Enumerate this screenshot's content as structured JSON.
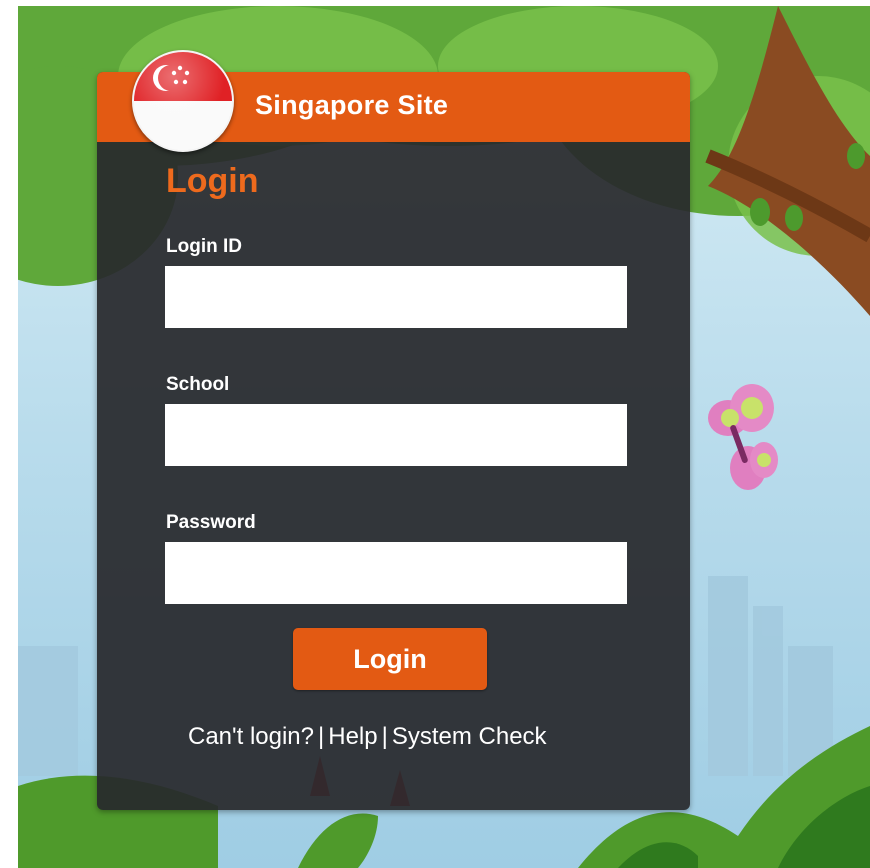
{
  "header": {
    "site_title": "Singapore Site"
  },
  "flag": {
    "icon": "singapore-flag-icon",
    "red": "#e02125",
    "white": "#fafafa"
  },
  "form": {
    "heading": "Login",
    "login_id": {
      "label": "Login ID",
      "value": "",
      "placeholder": ""
    },
    "school": {
      "label": "School",
      "value": "",
      "placeholder": ""
    },
    "password": {
      "label": "Password",
      "value": "",
      "placeholder": ""
    },
    "submit_label": "Login"
  },
  "footer": {
    "cant_login": "Can't login?",
    "separator": "|",
    "help": "Help",
    "system_check": "System Check"
  },
  "colors": {
    "accent": "#e35a13",
    "panel": "#28292c",
    "heading": "#ee6a1d"
  }
}
